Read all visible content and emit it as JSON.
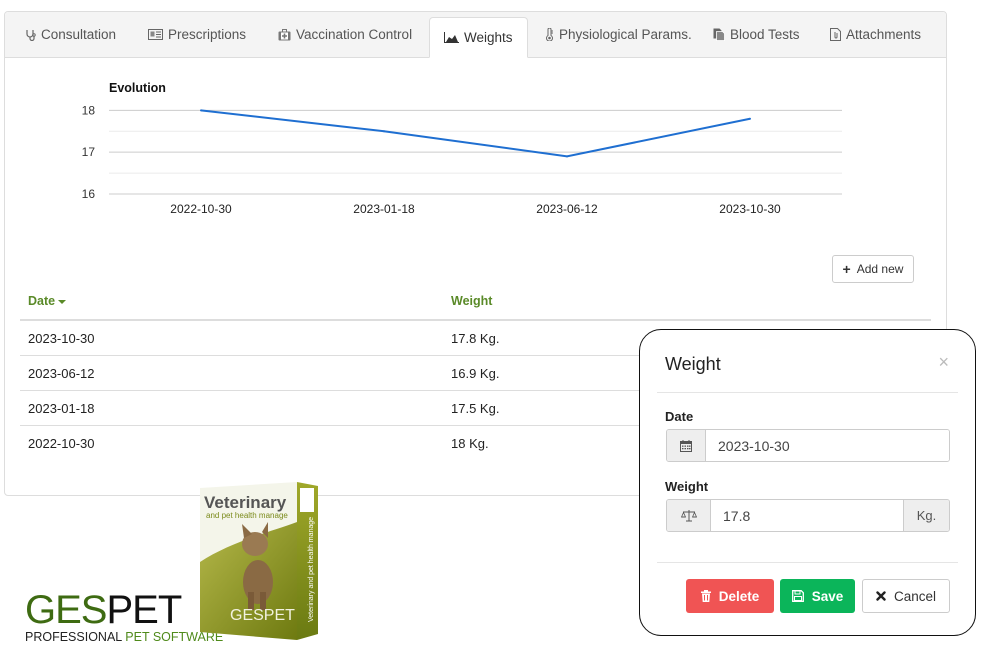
{
  "tabs": [
    {
      "label": "Consultation",
      "icon": "stethoscope-icon",
      "active": false
    },
    {
      "label": "Prescriptions",
      "icon": "prescription-card-icon",
      "active": false
    },
    {
      "label": "Vaccination Control",
      "icon": "medkit-icon",
      "active": false
    },
    {
      "label": "Weights",
      "icon": "area-chart-icon",
      "active": true
    },
    {
      "label": "Physiological Params.",
      "icon": "thermometer-icon",
      "active": false
    },
    {
      "label": "Blood Tests",
      "icon": "files-icon",
      "active": false
    },
    {
      "label": "Attachments",
      "icon": "file-attachment-icon",
      "active": false
    }
  ],
  "chart_data": {
    "type": "line",
    "title": "Evolution",
    "categories": [
      "2022-10-30",
      "2023-01-18",
      "2023-06-12",
      "2023-10-30"
    ],
    "series": [
      {
        "name": "Weight",
        "values": [
          18,
          17.5,
          16.9,
          17.8
        ],
        "color": "#1f6fd1"
      }
    ],
    "yticks": [
      16,
      17,
      18
    ],
    "ylim": [
      16,
      18.2
    ],
    "grid": true,
    "xlabel": "",
    "ylabel": ""
  },
  "toolbar": {
    "add_new_label": "Add new"
  },
  "table": {
    "columns": [
      {
        "label": "Date",
        "sorted": "desc"
      },
      {
        "label": "Weight"
      }
    ],
    "rows": [
      {
        "date": "2023-10-30",
        "weight": "17.8 Kg."
      },
      {
        "date": "2023-06-12",
        "weight": "16.9 Kg."
      },
      {
        "date": "2023-01-18",
        "weight": "17.5 Kg."
      },
      {
        "date": "2022-10-30",
        "weight": "18 Kg."
      }
    ]
  },
  "modal": {
    "title": "Weight",
    "close_label": "×",
    "date_label": "Date",
    "date_value": "2023-10-30",
    "weight_label": "Weight",
    "weight_value": "17.8",
    "weight_unit": "Kg.",
    "delete_label": "Delete",
    "save_label": "Save",
    "cancel_label": "Cancel"
  },
  "branding": {
    "logo_part1": "GES",
    "logo_part2": "PET",
    "tagline_part1": "PROFESSIONAL ",
    "tagline_part2": "PET SOFTWARE",
    "box_title": "Veterinary",
    "box_subtitle": "and pet health manage",
    "box_side_text": "Veterinary and pet health manage",
    "box_logo": "GESPET",
    "colors": {
      "green_dark": "#3e6b12",
      "olive": "#8a9a1c"
    }
  },
  "colors": {
    "header_green": "#5a8a28",
    "delete_red": "#f05454",
    "save_green": "#0bb55a",
    "chart_line": "#1f6fd1"
  }
}
